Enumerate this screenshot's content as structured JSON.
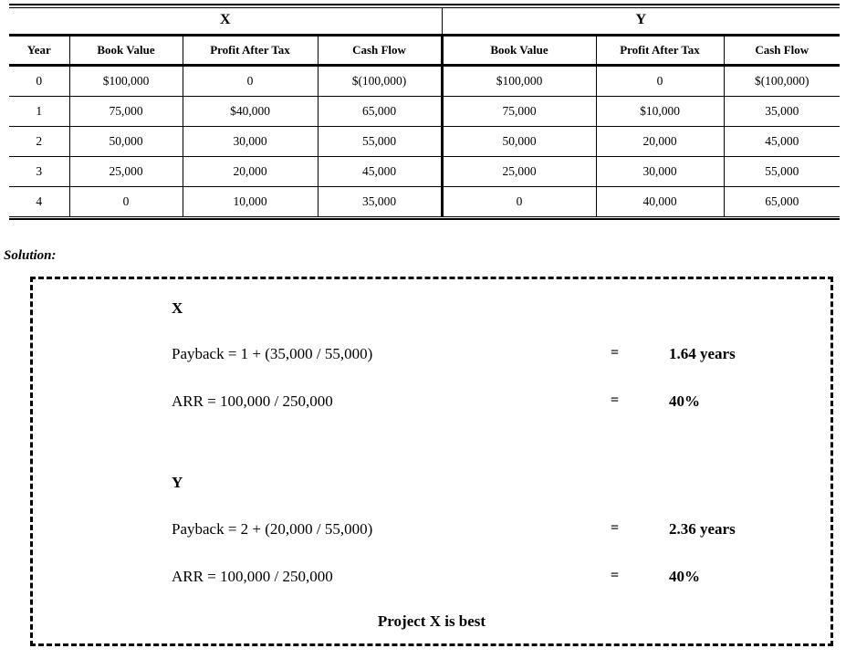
{
  "table": {
    "group_headers": [
      "X",
      "Y"
    ],
    "columns": [
      "Year",
      "Book Value",
      "Profit After Tax",
      "Cash Flow",
      "Book Value",
      "Profit After Tax",
      "Cash Flow"
    ],
    "rows": [
      [
        "0",
        "$100,000",
        "0",
        "$(100,000)",
        "$100,000",
        "0",
        "$(100,000)"
      ],
      [
        "1",
        "75,000",
        "$40,000",
        "65,000",
        "75,000",
        "$10,000",
        "35,000"
      ],
      [
        "2",
        "50,000",
        "30,000",
        "55,000",
        "50,000",
        "20,000",
        "45,000"
      ],
      [
        "3",
        "25,000",
        "20,000",
        "45,000",
        "25,000",
        "30,000",
        "55,000"
      ],
      [
        "4",
        "0",
        "10,000",
        "35,000",
        "0",
        "40,000",
        "65,000"
      ]
    ]
  },
  "solution": {
    "label": "Solution:",
    "projects": [
      {
        "title": "X",
        "payback_formula": "Payback = 1 + (35,000 / 55,000)",
        "payback_eq": "=",
        "payback_result": "1.64 years",
        "arr_formula": "ARR  =   100,000  /  250,000",
        "arr_eq": "=",
        "arr_result": "40%"
      },
      {
        "title": "Y",
        "payback_formula": "Payback = 2 + (20,000 / 55,000)",
        "payback_eq": "=",
        "payback_result": "2.36 years",
        "arr_formula": "ARR  =   100,000  /  250,000",
        "arr_eq": "=",
        "arr_result": "40%"
      }
    ],
    "verdict": "Project X is best"
  },
  "colors": {
    "ink": "#000000",
    "paper": "#ffffff"
  }
}
